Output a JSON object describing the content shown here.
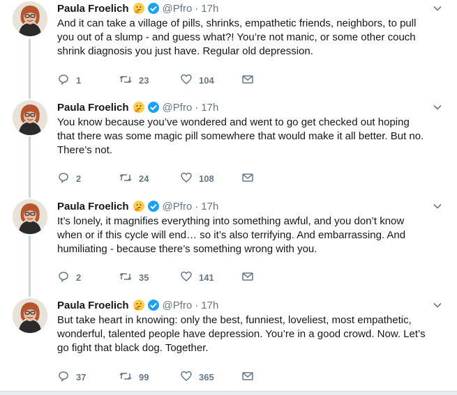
{
  "author": {
    "name": "Paula Froelich",
    "handle": "@Pfro",
    "separator": "·",
    "emoji_icon": "thinking-face-icon",
    "verified_icon": "verified-badge-icon"
  },
  "colors": {
    "text": "#14171a",
    "muted": "#657786",
    "verified": "#1da1f2",
    "thread_line": "#ccd6dd"
  },
  "tweets": [
    {
      "time": "17h",
      "lines": [
        "And it can take a village of pills, shrinks, empathetic friends, neighbors, to pull",
        "you out of a slump - and guess what?! You’re not manic, or some other couch",
        "shrink diagnosis you just have. Regular old depression."
      ],
      "replies": "1",
      "retweets": "23",
      "likes": "104"
    },
    {
      "time": "17h",
      "lines": [
        "You know because you’ve wondered and went to go get checked out hoping",
        "that there was some magic pill somewhere that would make it all better. But no.",
        "There’s not."
      ],
      "replies": "2",
      "retweets": "24",
      "likes": "108"
    },
    {
      "time": "17h",
      "lines": [
        "It’s lonely, it magnifies everything into something awful, and you don’t know",
        "when or if this cycle will end… so it’s also terrifying. And embarrassing. And",
        "humiliating - because there’s something wrong with you."
      ],
      "replies": "2",
      "retweets": "35",
      "likes": "141"
    },
    {
      "time": "17h",
      "lines": [
        "But take heart in knowing: only the best, funniest, loveliest, most empathetic,",
        "wonderful, talented people have depression. You’re in a good crowd. Now. Let’s",
        "go fight that black dog. Together."
      ],
      "replies": "37",
      "retweets": "99",
      "likes": "365"
    }
  ]
}
